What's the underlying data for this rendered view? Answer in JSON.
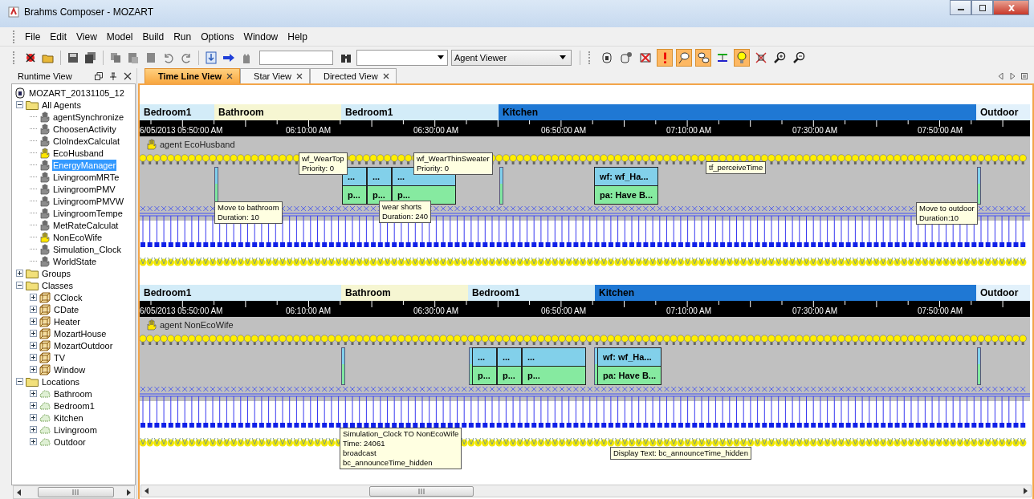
{
  "window": {
    "title": "Brahms Composer - MOZART"
  },
  "menu": [
    "File",
    "Edit",
    "View",
    "Model",
    "Build",
    "Run",
    "Options",
    "Window",
    "Help"
  ],
  "toolbar": {
    "viewer": "Agent Viewer",
    "toggles": [
      {
        "on": false
      },
      {
        "on": false
      },
      {
        "on": false
      },
      {
        "on": true
      },
      {
        "on": true
      },
      {
        "on": true
      },
      {
        "on": false
      },
      {
        "on": true
      },
      {
        "on": false
      },
      {
        "on": false
      },
      {
        "on": false
      }
    ]
  },
  "runtime_view": {
    "title": "Runtime View",
    "tree": [
      {
        "label": "MOZART_20131105_12",
        "kind": "model",
        "selected": false,
        "children": [
          {
            "label": "All Agents",
            "kind": "folder",
            "expanded": true,
            "selected": false,
            "children": [
              {
                "label": "agentSynchronize",
                "kind": "agent",
                "active": false,
                "selected": false
              },
              {
                "label": "ChoosenActivity",
                "kind": "agent",
                "active": false,
                "selected": false
              },
              {
                "label": "CloIndexCalculat",
                "kind": "agent",
                "active": false,
                "selected": false
              },
              {
                "label": "EcoHusband",
                "kind": "agent",
                "active": true,
                "selected": false
              },
              {
                "label": "EnergyManager",
                "kind": "agent",
                "active": false,
                "selected": true
              },
              {
                "label": "LivingroomMRTe",
                "kind": "agent",
                "active": false,
                "selected": false
              },
              {
                "label": "LivingroomPMV",
                "kind": "agent",
                "active": false,
                "selected": false
              },
              {
                "label": "LivingroomPMVW",
                "kind": "agent",
                "active": false,
                "selected": false
              },
              {
                "label": "LivingroomTempe",
                "kind": "agent",
                "active": false,
                "selected": false
              },
              {
                "label": "MetRateCalculat",
                "kind": "agent",
                "active": false,
                "selected": false
              },
              {
                "label": "NonEcoWife",
                "kind": "agent",
                "active": true,
                "selected": false
              },
              {
                "label": "Simulation_Clock",
                "kind": "agent",
                "active": false,
                "selected": false
              },
              {
                "label": "WorldState",
                "kind": "agent",
                "active": false,
                "selected": false
              }
            ]
          },
          {
            "label": "Groups",
            "kind": "folder",
            "expanded": false,
            "selected": false
          },
          {
            "label": "Classes",
            "kind": "folder",
            "expanded": true,
            "selected": false,
            "children": [
              {
                "label": "CClock",
                "kind": "class",
                "expanded": false,
                "selected": false
              },
              {
                "label": "CDate",
                "kind": "class",
                "expanded": false,
                "selected": false
              },
              {
                "label": "Heater",
                "kind": "class",
                "expanded": false,
                "selected": false
              },
              {
                "label": "MozartHouse",
                "kind": "class",
                "expanded": false,
                "selected": false
              },
              {
                "label": "MozartOutdoor",
                "kind": "class",
                "expanded": false,
                "selected": false
              },
              {
                "label": "TV",
                "kind": "class",
                "expanded": false,
                "selected": false
              },
              {
                "label": "Window",
                "kind": "class",
                "expanded": false,
                "selected": false
              }
            ]
          },
          {
            "label": "Locations",
            "kind": "folder",
            "expanded": true,
            "selected": false,
            "children": [
              {
                "label": "Bathroom",
                "kind": "location",
                "expanded": false,
                "selected": false
              },
              {
                "label": "Bedroom1",
                "kind": "location",
                "expanded": false,
                "selected": false
              },
              {
                "label": "Kitchen",
                "kind": "location",
                "expanded": false,
                "selected": false
              },
              {
                "label": "Livingroom",
                "kind": "location",
                "expanded": false,
                "selected": false
              },
              {
                "label": "Outdoor",
                "kind": "location",
                "expanded": false,
                "selected": false
              }
            ]
          }
        ]
      }
    ]
  },
  "tabs": [
    {
      "label": "Time Line View",
      "selected": true
    },
    {
      "label": "Star View",
      "selected": false
    },
    {
      "label": "Directed View",
      "selected": false
    }
  ],
  "timelines": [
    {
      "agent": "agent EcoHusband",
      "locations": [
        {
          "name": "Bedroom1",
          "color": "#d3ecf8"
        },
        {
          "name": "Bathroom",
          "color": "#f6f6d2"
        },
        {
          "name": "Bedroom1",
          "color": "#d3ecf8"
        },
        {
          "name": "Kitchen",
          "color": "#1f78d4"
        },
        {
          "name": "Outdoor",
          "color": "#e2f1fb"
        }
      ],
      "time_labels": [
        "6/05/2013 05:50:00 AM",
        "06:10:00 AM",
        "06:30:00 AM",
        "06:50:00 AM",
        "07:10:00 AM",
        "07:30:00 AM",
        "07:50:00 AM"
      ],
      "activities": [
        {
          "kind": "marker"
        },
        {
          "kind": "cell",
          "workframe": "...",
          "activity": "p..."
        },
        {
          "kind": "cell",
          "workframe": "...",
          "activity": "p..."
        },
        {
          "kind": "cell",
          "workframe": "...",
          "activity": "p..."
        },
        {
          "kind": "marker"
        },
        {
          "kind": "cell",
          "workframe": "wf: wf_Ha...",
          "activity": "pa: Have B..."
        },
        {
          "kind": "marker"
        }
      ],
      "tooltips": [
        {
          "lines": [
            "wf_WearTop",
            "Priority: 0"
          ]
        },
        {
          "lines": [
            "wf_WearThinSweater",
            "Priority: 0"
          ]
        },
        {
          "lines": [
            "Move to bathroom",
            "Duration: 10"
          ]
        },
        {
          "lines": [
            "wear shorts",
            "Duration: 240"
          ]
        },
        {
          "lines": [
            "tf_perceiveTime"
          ]
        },
        {
          "lines": [
            "Move to outdoor",
            "Duration:10"
          ]
        }
      ]
    },
    {
      "agent": "agent NonEcoWife",
      "locations": [
        {
          "name": "Bedroom1",
          "color": "#d3ecf8"
        },
        {
          "name": "Bathroom",
          "color": "#f6f6d2"
        },
        {
          "name": "Bedroom1",
          "color": "#d3ecf8"
        },
        {
          "name": "Kitchen",
          "color": "#1f78d4"
        },
        {
          "name": "Outdoor",
          "color": "#e2f1fb"
        }
      ],
      "time_labels": [
        "6/05/2013 05:50:00 AM",
        "06:10:00 AM",
        "06:30:00 AM",
        "06:50:00 AM",
        "07:10:00 AM",
        "07:30:00 AM",
        "07:50:00 AM"
      ],
      "activities": [
        {
          "kind": "marker"
        },
        {
          "kind": "marker"
        },
        {
          "kind": "cell",
          "workframe": "...",
          "activity": "p..."
        },
        {
          "kind": "cell",
          "workframe": "...",
          "activity": "p..."
        },
        {
          "kind": "cell",
          "workframe": "...",
          "activity": "p..."
        },
        {
          "kind": "marker"
        },
        {
          "kind": "cell",
          "workframe": "wf: wf_Ha...",
          "activity": "pa: Have B..."
        },
        {
          "kind": "marker"
        }
      ],
      "tooltips": [
        {
          "lines": [
            "Simulation_Clock TO NonEcoWife",
            "Time: 24061",
            "broadcast",
            "bc_announceTime_hidden"
          ]
        },
        {
          "lines": [
            "Display Text: bc_announceTime_hidden"
          ]
        }
      ]
    }
  ]
}
